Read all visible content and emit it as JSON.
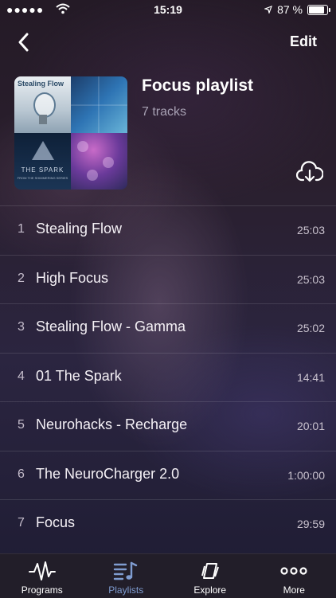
{
  "status_bar": {
    "carrier": "●●●●●",
    "time": "15:19",
    "battery": "87 %",
    "battery_level": 0.87
  },
  "nav": {
    "edit_label": "Edit"
  },
  "playlist": {
    "title": "Focus playlist",
    "track_count": "7 tracks",
    "cover": {
      "tile1_title": "Stealing Flow",
      "tile3_title": "THE SPARK",
      "tile3_subtitle": "FROM THE SHIMMERING SERIES"
    }
  },
  "tracks": [
    {
      "number": "1",
      "name": "Stealing Flow",
      "duration": "25:03"
    },
    {
      "number": "2",
      "name": "High Focus",
      "duration": "25:03"
    },
    {
      "number": "3",
      "name": "Stealing Flow - Gamma",
      "duration": "25:02"
    },
    {
      "number": "4",
      "name": "01 The Spark",
      "duration": "14:41"
    },
    {
      "number": "5",
      "name": "Neurohacks - Recharge",
      "duration": "20:01"
    },
    {
      "number": "6",
      "name": "The NeuroCharger 2.0",
      "duration": "1:00:00"
    },
    {
      "number": "7",
      "name": "Focus",
      "duration": "29:59"
    }
  ],
  "tabbar": {
    "programs_label": "Programs",
    "playlists_label": "Playlists",
    "explore_label": "Explore",
    "more_label": "More",
    "active_tab": "Playlists",
    "active_color": "#7f9cd0"
  }
}
